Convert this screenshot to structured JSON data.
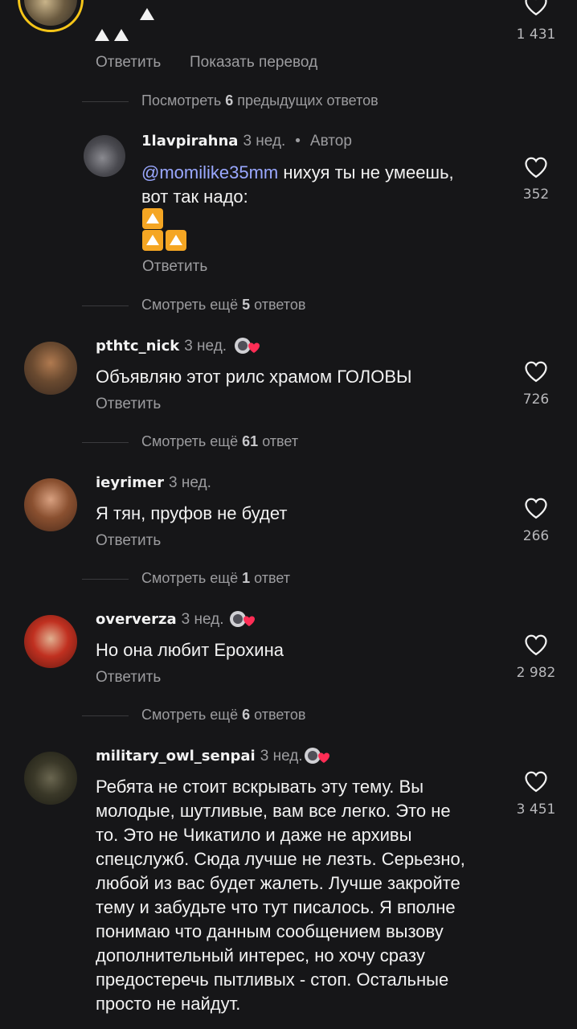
{
  "colors": {
    "background": "#161618",
    "text": "#f2f2f2",
    "muted": "#9c9c9f",
    "mention": "#9aa8ff",
    "story_ring": "#f5c518"
  },
  "top_comment": {
    "likes": "1 431",
    "reply": "Ответить",
    "translate": "Показать перевод",
    "view_previous": {
      "prefix": "Посмотреть",
      "count": "6",
      "suffix": "предыдущих ответов"
    }
  },
  "comments": [
    {
      "username": "1lavpirahna",
      "age": "3 нед.",
      "author_label": "Автор",
      "mention": "@momilike35mm",
      "text_line1": " нихуя ты не умеешь,",
      "text_line2": "вот так надо:",
      "reply": "Ответить",
      "likes": "352",
      "view_more": {
        "prefix": "Смотреть ещё",
        "count": "5",
        "suffix": "ответов"
      }
    },
    {
      "username": "pthtc_nick",
      "age": "3 нед.",
      "text": "Объявляю этот рилс храмом ГОЛОВЫ",
      "reply": "Ответить",
      "likes": "726",
      "view_more": {
        "prefix": "Смотреть ещё",
        "count": "61",
        "suffix": "ответ"
      }
    },
    {
      "username": "ieyrimer",
      "age": "3 нед.",
      "text": "Я тян, пруфов не будет",
      "reply": "Ответить",
      "likes": "266",
      "view_more": {
        "prefix": "Смотреть ещё",
        "count": "1",
        "suffix": "ответ"
      }
    },
    {
      "username": "oververza",
      "age": "3 нед.",
      "text": "Но она любит Ерохина",
      "reply": "Ответить",
      "likes": "2 982",
      "view_more": {
        "prefix": "Смотреть ещё",
        "count": "6",
        "suffix": "ответов"
      }
    },
    {
      "username": "military_owl_senpai",
      "age": "3 нед.",
      "lines": [
        "Ребята не стоит вскрывать эту тему. Вы",
        "молодые, шутливые, вам все легко. Это не",
        "то. Это не Чикатило и даже не архивы",
        "спецслужб. Сюда лучше не лезть. Серьезно,",
        "любой из вас будет жалеть. Лучше закройте",
        "тему и забудьте что тут писалось. Я вполне",
        "понимаю что данным сообщением вызову",
        "дополнительный интерес, но хочу сразу",
        "предостеречь пытливых - стоп. Остальные",
        "просто не найдут."
      ],
      "likes": "3 451"
    }
  ]
}
